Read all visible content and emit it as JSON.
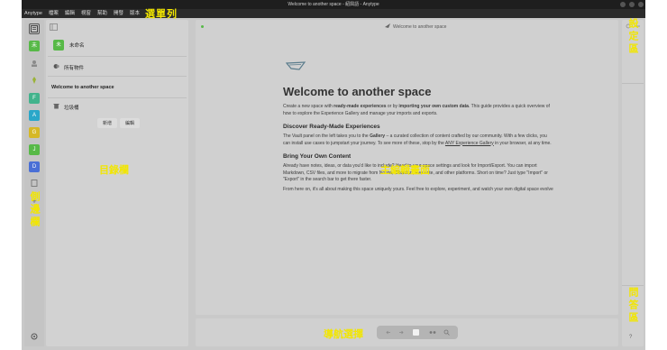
{
  "window": {
    "title": "Welcome to another space - 紹興語 - Anytype"
  },
  "menubar": {
    "items": [
      "Anytype",
      "檔案",
      "編輯",
      "視窗",
      "幫助",
      "開發",
      "版本"
    ]
  },
  "annotations": {
    "menubar": "選單列",
    "sidebar_left": "側邊欄",
    "directory": "目錄欄",
    "main_editor": "主編輯畫面",
    "settings": "設定區",
    "nav": "導航選擇",
    "help": "問答區"
  },
  "rail": {
    "spaces": [
      {
        "letter": "未",
        "color": "#57b947"
      },
      {
        "letter": "F",
        "color": "#42b38c"
      },
      {
        "letter": "A",
        "color": "#2aa7c9"
      },
      {
        "letter": "G",
        "color": "#d6b825"
      },
      {
        "letter": "J",
        "color": "#57b947"
      },
      {
        "letter": "D",
        "color": "#4a6fd6"
      }
    ],
    "add": "+"
  },
  "sidebar": {
    "space_badge": "未",
    "space_name": "未命名",
    "all_objects": "所有物件",
    "page_title": "Welcome to another space",
    "bin": "垃圾桶",
    "btn_new": "新增",
    "btn_edit": "編輯"
  },
  "editor": {
    "breadcrumb": "Welcome to another space",
    "title": "Welcome to another space",
    "intro_1": "Create a new space with ",
    "intro_b1": "ready-made experiences",
    "intro_2": " or by ",
    "intro_b2": "importing your own custom data",
    "intro_3": ". This guide provides a quick overview of how to explore the Experience Gallery and manage your imports and exports.",
    "h_discover": "Discover Ready-Made Experiences",
    "p_discover_1": "The Vault panel on the left takes you to the ",
    "p_discover_b": "Gallery",
    "p_discover_2": " – a curated collection of content crafted by our community. With a few clicks, you can install use cases to jumpstart your journey. To see more of these, stop by the ",
    "p_discover_link": "ANY Experience Gallery",
    "p_discover_3": " in your browser, at any time.",
    "h_bring": "Bring Your Own Content",
    "p_bring": "Already have notes, ideas, or data you'd like to include? Head to your space settings and look for Import/Export. You can import Markdown, CSV files, and more to migrate from Notion, Obsidian, Evernote, and other platforms. Short on time? Just type \"Import\" or \"Export\" in the search bar to get there faster.",
    "p_final": "From here on, it's all about making this space uniquely yours. Feel free to explore, experiment, and watch your own digital space evolve"
  },
  "rightpanel": {
    "help": "?"
  },
  "colors": {
    "annotation": "#f2e600",
    "titlebar": "#1e1e1e",
    "menubar": "#2b2b2b"
  }
}
